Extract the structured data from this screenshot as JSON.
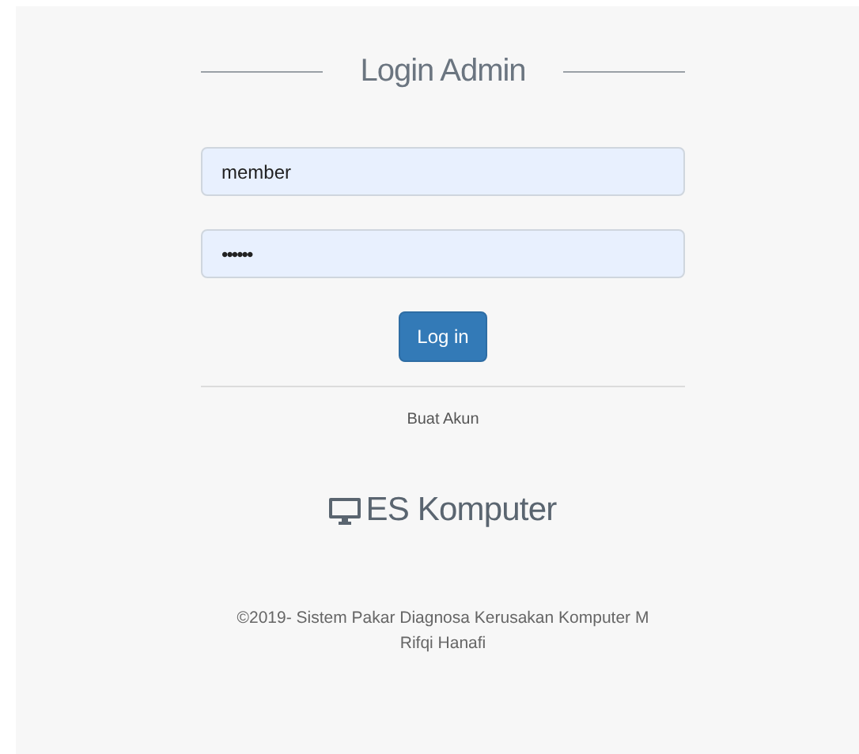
{
  "title": "Login Admin",
  "fields": [
    {
      "kind": "text",
      "value": "member"
    },
    {
      "kind": "password",
      "value": "••••••"
    }
  ],
  "login_button": "Log in",
  "register_link": "Buat Akun",
  "brand": "ES Komputer",
  "footer": [
    "©2019- Sistem Pakar Diagnosa Kerusakan Komputer M",
    "Rifqi Hanafi"
  ]
}
